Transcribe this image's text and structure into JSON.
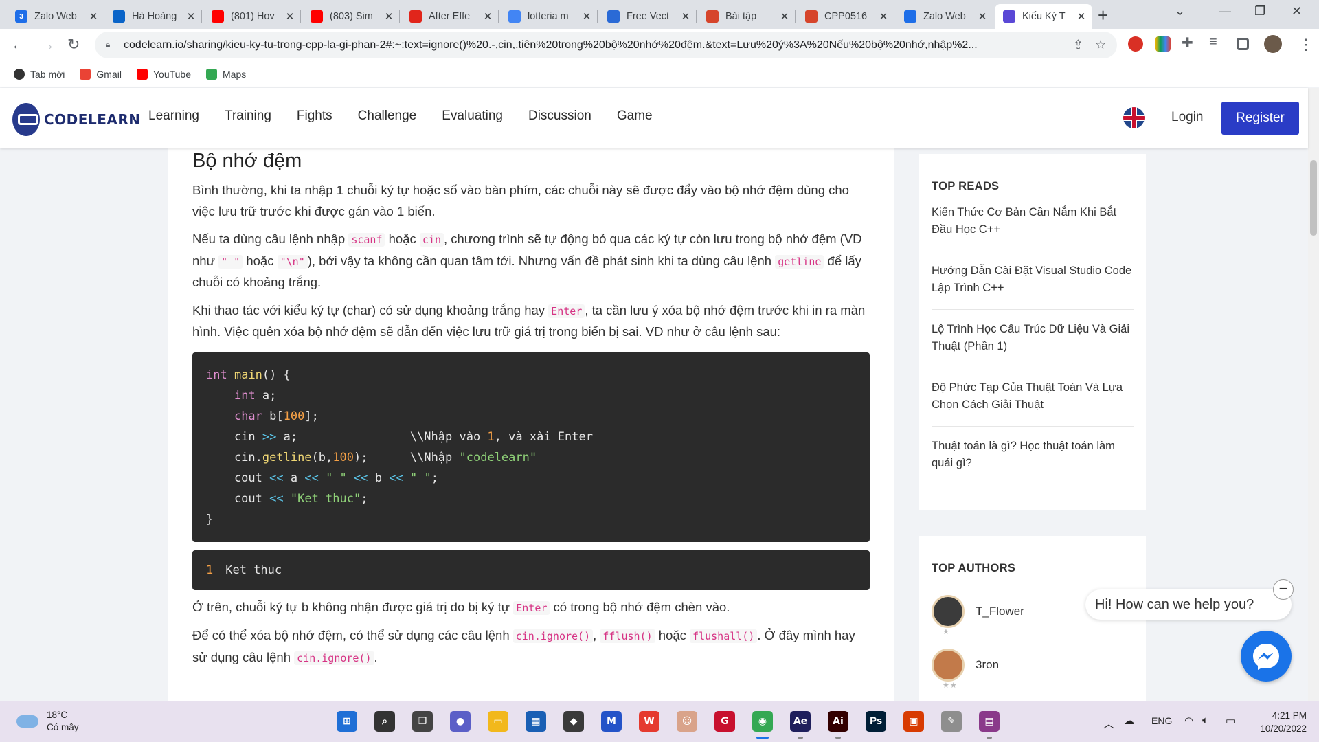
{
  "browser": {
    "tabs": [
      {
        "title": "Zalo Web",
        "favicon": "zalo-icon",
        "color": "#1e6ee8",
        "badge": "3"
      },
      {
        "title": "Hà Hoàng",
        "favicon": "onedrive-icon",
        "color": "#0a64c8"
      },
      {
        "title": "(801) Hov",
        "favicon": "youtube-icon",
        "color": "#ff0000"
      },
      {
        "title": "(803) Sim",
        "favicon": "youtube-icon",
        "color": "#ff0000"
      },
      {
        "title": "After Effe",
        "favicon": "adobe-icon",
        "color": "#e1251b"
      },
      {
        "title": "lotteria m",
        "favicon": "google-icon",
        "color": "#4285f4"
      },
      {
        "title": "Free Vect",
        "favicon": "freepik-icon",
        "color": "#2a6ad6"
      },
      {
        "title": "Bài tập",
        "favicon": "pdf-icon",
        "color": "#d6452b"
      },
      {
        "title": "CPP0516",
        "favicon": "pdf-icon",
        "color": "#d6452b"
      },
      {
        "title": "Zalo Web",
        "favicon": "zalo-icon",
        "color": "#1e6ee8"
      },
      {
        "title": "Kiểu Ký T",
        "favicon": "codelearn-icon",
        "color": "#5a48d6"
      }
    ],
    "url": "codelearn.io/sharing/kieu-ky-tu-trong-cpp-la-gi-phan-2#:~:text=ignore()%20.-,cin,.tiên%20trong%20bộ%20nhớ%20đệm.&text=Lưu%20ý%3A%20Nếu%20bộ%20nhớ,nhập%2...",
    "bookmarks": [
      {
        "label": "Tab mới",
        "icon": "github-icon",
        "color": "#333333"
      },
      {
        "label": "Gmail",
        "icon": "gmail-icon",
        "color": "#ea4335"
      },
      {
        "label": "YouTube",
        "icon": "youtube-icon",
        "color": "#ff0000"
      },
      {
        "label": "Maps",
        "icon": "maps-icon",
        "color": "#34a853"
      }
    ]
  },
  "site": {
    "logo_text": "CODELEARN",
    "nav": [
      "Learning",
      "Training",
      "Fights",
      "Challenge",
      "Evaluating",
      "Discussion",
      "Game"
    ],
    "login": "Login",
    "register": "Register"
  },
  "article": {
    "heading": "Bộ nhớ đệm",
    "p1": "Bình thường, khi ta nhập 1 chuỗi ký tự hoặc số vào bàn phím, các chuỗi này sẽ được đẩy vào bộ nhớ đệm dùng cho việc lưu trữ trước khi được gán vào 1 biến.",
    "p2": {
      "a": "Nếu ta dùng câu lệnh nhập ",
      "code1": "scanf",
      "b": " hoặc ",
      "code2": "cin",
      "c": ", chương trình sẽ tự động bỏ qua các ký tự còn lưu trong bộ nhớ đệm (VD như ",
      "code3": "\" \"",
      "d": " hoặc ",
      "code4": "\"\\n\"",
      "e": "), bởi vậy ta không cần quan tâm tới. Nhưng vấn đề phát sinh khi ta dùng câu lệnh ",
      "code5": "getline",
      "f": " để lấy chuỗi có khoảng trắng."
    },
    "p3": {
      "a": "Khi thao tác với kiểu ký tự (char) có sử dụng khoảng trắng hay ",
      "code1": "Enter",
      "b": ", ta cần lưu ý xóa bộ nhớ đệm trước khi in ra màn hình. Việc quên xóa bộ nhớ đệm sẽ dẫn đến việc lưu trữ giá trị trong biến bị sai. VD như ở câu lệnh sau:"
    },
    "code_lines": [
      "int main() {",
      "    int a;",
      "    char b[100];",
      "    cin >> a;                \\\\Nhập vào 1, và xài Enter",
      "    cin.getline(b,100);      \\\\Nhập \"codelearn\"",
      "    cout << a << \" \" << b << \" \";",
      "    cout << \"Ket thuc\";",
      "}"
    ],
    "output_line_no": "1",
    "output_text": "Ket thuc",
    "p4": {
      "a": "Ở trên, chuỗi ký tự b không nhận được giá trị do bị ký tự ",
      "code1": "Enter",
      "b": " có trong bộ nhớ đệm chèn vào."
    },
    "p5": {
      "a": "Để có thể xóa bộ nhớ đệm, có thể sử dụng các câu lệnh ",
      "code1": "cin.ignore()",
      "b": ", ",
      "code2": "fflush()",
      "c": " hoặc ",
      "code3": "flushall()",
      "d": ". Ở đây mình hay sử dụng câu lệnh ",
      "code4": "cin.ignore()",
      "e": "."
    }
  },
  "sidebar": {
    "top_reads_title": "TOP READS",
    "top_reads": [
      "Kiến Thức Cơ Bản Cần Nắm Khi Bắt Đầu Học C++",
      "Hướng Dẫn Cài Đặt Visual Studio Code Lập Trình C++",
      "Lộ Trình Học Cấu Trúc Dữ Liệu Và Giải Thuật (Phần 1)",
      "Độ Phức Tạp Của Thuật Toán Và Lựa Chọn Cách Giải Thuật",
      "Thuật toán là gì? Học thuật toán làm quái gì?"
    ],
    "top_authors_title": "TOP AUTHORS",
    "authors": [
      {
        "name": "T_Flower",
        "stars": "★"
      },
      {
        "name": "3ron",
        "stars": "★★"
      }
    ]
  },
  "chat": {
    "greeting": "Hi! How can we help you?",
    "close": "−"
  },
  "taskbar": {
    "temperature": "18°C",
    "condition": "Có mây",
    "language": "ENG",
    "time": "4:21 PM",
    "date": "10/20/2022",
    "apps": [
      {
        "name": "windows-start-icon",
        "color": "#1f6fd6",
        "glyph": "⊞"
      },
      {
        "name": "search-icon",
        "color": "#333333",
        "glyph": "⌕"
      },
      {
        "name": "task-view-icon",
        "color": "#444444",
        "glyph": "❐"
      },
      {
        "name": "teams-chat-icon",
        "color": "#5b5fc7",
        "glyph": "●"
      },
      {
        "name": "file-explorer-icon",
        "color": "#f2b81c",
        "glyph": "▭"
      },
      {
        "name": "microsoft-store-icon",
        "color": "#1a5fb4",
        "glyph": "▦"
      },
      {
        "name": "unity-icon",
        "color": "#3a3a3a",
        "glyph": "◆"
      },
      {
        "name": "vscode-icon",
        "color": "#2453c8",
        "glyph": "M"
      },
      {
        "name": "wps-icon",
        "color": "#e53a2f",
        "glyph": "W"
      },
      {
        "name": "anime-app-icon",
        "color": "#d9a38a",
        "glyph": "☺"
      },
      {
        "name": "garena-icon",
        "color": "#c8102e",
        "glyph": "G"
      },
      {
        "name": "chrome-icon",
        "color": "#34a853",
        "glyph": "◉"
      },
      {
        "name": "after-effects-icon",
        "color": "#1f1f5c",
        "glyph": "Ae"
      },
      {
        "name": "illustrator-icon",
        "color": "#330000",
        "glyph": "Ai"
      },
      {
        "name": "photoshop-icon",
        "color": "#001e36",
        "glyph": "Ps"
      },
      {
        "name": "office-icon",
        "color": "#d83b01",
        "glyph": "▣"
      },
      {
        "name": "paint-icon",
        "color": "#8e8e8e",
        "glyph": "✎"
      },
      {
        "name": "winrar-icon",
        "color": "#8a3a8a",
        "glyph": "▤"
      }
    ]
  }
}
